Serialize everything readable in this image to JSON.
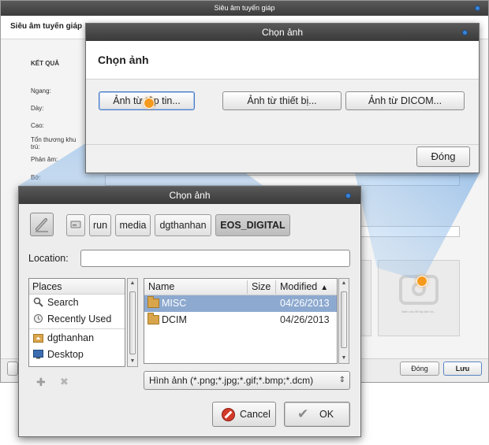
{
  "background_window": {
    "title": "Siêu âm tuyến giáp",
    "header": "Siêu âm tuyến giáp",
    "section_title": "KẾT QUẢ",
    "fields": [
      "Ngang:",
      "Dày:",
      "Cao:",
      "Tổn thương khu trú:",
      "Phản âm:",
      "Bờ:"
    ],
    "image_caption": "Bấm vào để lấy ảnh từ...",
    "close_label": "Đóng",
    "save_label": "Lưu"
  },
  "source_dialog": {
    "title": "Chọn ảnh",
    "heading": "Chọn ảnh",
    "buttons": {
      "from_file": "Ảnh từ tập tin...",
      "from_device": "Ảnh từ thiết bị...",
      "from_dicom": "Ảnh từ DICOM..."
    },
    "close_label": "Đóng"
  },
  "file_chooser": {
    "title": "Chọn ảnh",
    "path": [
      "run",
      "media",
      "dgthanhan",
      "EOS_DIGITAL"
    ],
    "location_label": "Location:",
    "location_value": "",
    "places": {
      "header": "Places",
      "items": [
        {
          "label": "Search",
          "icon": "search-icon"
        },
        {
          "label": "Recently Used",
          "icon": "recent-icon"
        },
        {
          "label": "dgthanhan",
          "icon": "home-folder-icon"
        },
        {
          "label": "Desktop",
          "icon": "desktop-icon"
        }
      ]
    },
    "files": {
      "columns": [
        "Name",
        "Size",
        "Modified"
      ],
      "rows": [
        {
          "name": "MISC",
          "size": "",
          "modified": "04/26/2013",
          "selected": true
        },
        {
          "name": "DCIM",
          "size": "",
          "modified": "04/26/2013",
          "selected": false
        }
      ]
    },
    "filter": "Hình ảnh (*.png;*.jpg;*.gif;*.bmp;*.dcm)",
    "cancel_label": "Cancel",
    "ok_label": "OK"
  },
  "colors": {
    "accent_highlight": "#f59a1c",
    "selection": "#8da9cf",
    "titlebar": "#3a3a3a"
  }
}
